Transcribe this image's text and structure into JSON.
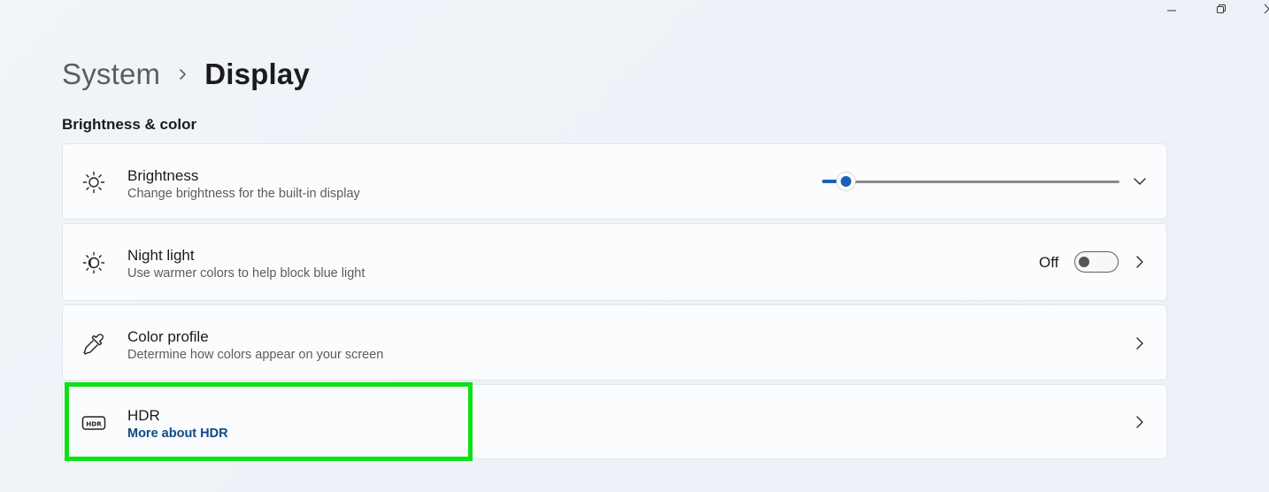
{
  "window": {
    "controls": [
      {
        "name": "minimize",
        "icon": "minimize-icon"
      },
      {
        "name": "restore",
        "icon": "restore-icon"
      },
      {
        "name": "close",
        "icon": "close-icon"
      }
    ]
  },
  "breadcrumb": {
    "parent": "System",
    "separator_icon": "chevron-right-icon",
    "current": "Display"
  },
  "section": {
    "title": "Brightness & color"
  },
  "settings": {
    "brightness": {
      "icon": "sun-icon",
      "title": "Brightness",
      "subtitle": "Change brightness for the built-in display",
      "level_percent": 8,
      "accent_color": "#1a62b8",
      "expand_icon": "chevron-down-icon"
    },
    "night_light": {
      "icon": "night-light-icon",
      "title": "Night light",
      "subtitle": "Use warmer colors to help block blue light",
      "state_label": "Off",
      "state": false,
      "nav_icon": "chevron-right-icon"
    },
    "color_profile": {
      "icon": "eyedropper-icon",
      "title": "Color profile",
      "subtitle": "Determine how colors appear on your screen",
      "nav_icon": "chevron-right-icon"
    },
    "hdr": {
      "icon": "hdr-icon",
      "title": "HDR",
      "link": "More about HDR",
      "nav_icon": "chevron-right-icon",
      "highlight_color": "#0ee016"
    }
  }
}
